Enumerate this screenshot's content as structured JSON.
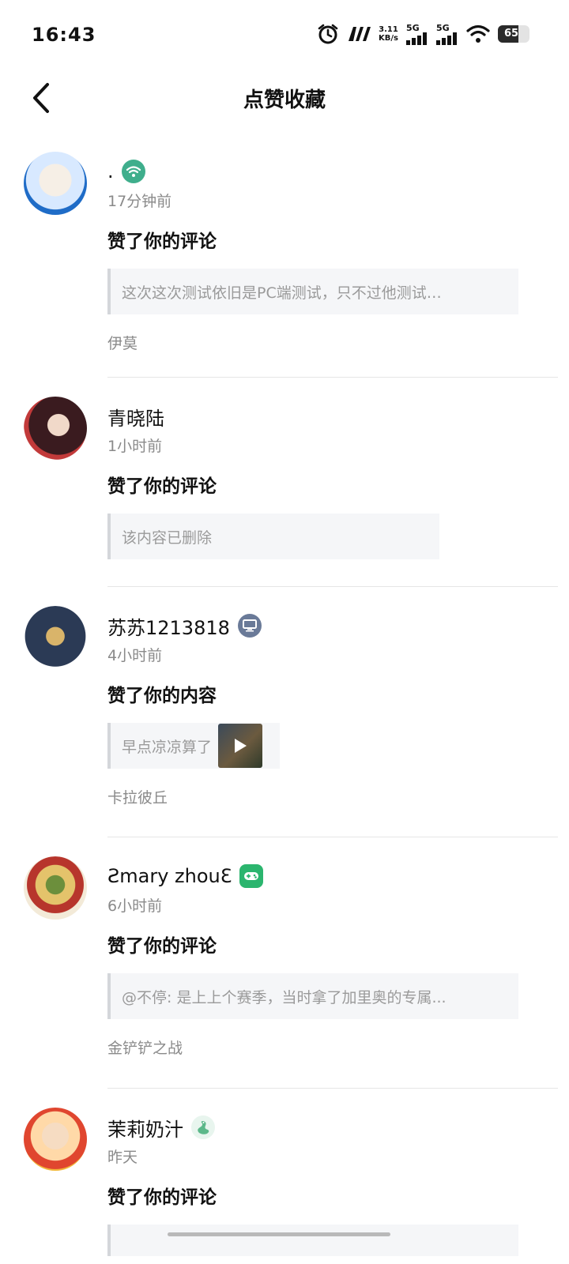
{
  "status_bar": {
    "time": "16:43",
    "net_speed_value": "3.11",
    "net_speed_unit": "KB/s",
    "signal1_label": "5G",
    "signal2_label": "5G",
    "battery_level": "65",
    "battery_fraction": 0.65
  },
  "header": {
    "title": "点赞收藏"
  },
  "notifications": [
    {
      "user_name": ".",
      "badge_icon": "wifi-badge-icon",
      "badge_color": "#3fae8c",
      "avatar_colors": [
        "#d8e9ff",
        "#1f6cc7"
      ],
      "time": "17分钟前",
      "action": "赞了你的评论",
      "quote": "这次这次测试依旧是PC端测试，只不过他测试…",
      "origin": "伊莫"
    },
    {
      "user_name": "青晓陆",
      "avatar_colors": [
        "#3a1b1f",
        "#c23a3a"
      ],
      "time": "1小时前",
      "action": "赞了你的评论",
      "quote": "该内容已删除",
      "origin": ""
    },
    {
      "user_name": "苏苏1213818",
      "badge_icon": "computer-badge-icon",
      "badge_color": "#6a7a98",
      "avatar_colors": [
        "#2b3a55",
        "#b8924a"
      ],
      "time": "4小时前",
      "action": "赞了你的内容",
      "quote": "早点凉凉算了",
      "origin": "卡拉彼丘"
    },
    {
      "user_name": "Ƨmary zhouƐ",
      "badge_icon": "gamepad-badge-icon",
      "badge_color": "#2bb56e",
      "avatar_colors": [
        "#f3ead8",
        "#b7352c"
      ],
      "time": "6小时前",
      "action": "赞了你的评论",
      "quote": "@不停: 是上上个赛季，当时拿了加里奥的专属...",
      "origin": "金铲铲之战"
    },
    {
      "user_name": "茉莉奶汁",
      "badge_icon": "snake-badge-icon",
      "badge_color": "#5cb88a",
      "avatar_colors": [
        "#ffd9a8",
        "#e0462f"
      ],
      "time": "昨天",
      "action": "赞了你的评论",
      "quote": "",
      "origin": ""
    }
  ]
}
